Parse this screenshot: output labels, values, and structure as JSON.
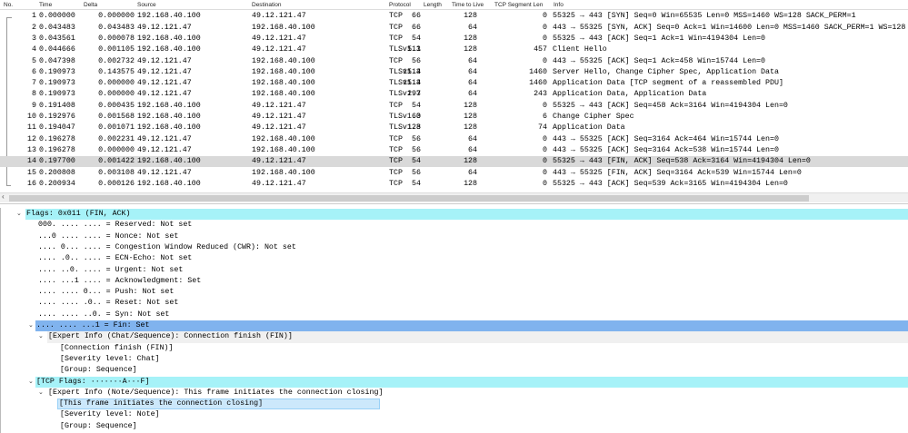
{
  "columns": [
    "No.",
    "Time",
    "Delta",
    "Source",
    "Destination",
    "Protocol",
    "Length",
    "Time to Live",
    "TCP Segment Len",
    "Info"
  ],
  "packets": [
    [
      "1",
      "0.000000",
      "0.000000",
      "192.168.40.100",
      "49.12.121.47",
      "TCP",
      "66",
      "128",
      "0",
      "55325 → 443 [SYN] Seq=0 Win=65535 Len=0 MSS=1460 WS=128 SACK_PERM=1"
    ],
    [
      "2",
      "0.043483",
      "0.043483",
      "49.12.121.47",
      "192.168.40.100",
      "TCP",
      "66",
      "64",
      "0",
      "443 → 55325 [SYN, ACK] Seq=0 Ack=1 Win=14600 Len=0 MSS=1460 SACK_PERM=1 WS=128"
    ],
    [
      "3",
      "0.043561",
      "0.000078",
      "192.168.40.100",
      "49.12.121.47",
      "TCP",
      "54",
      "128",
      "0",
      "55325 → 443 [ACK] Seq=1 Ack=1 Win=4194304 Len=0"
    ],
    [
      "4",
      "0.044666",
      "0.001105",
      "192.168.40.100",
      "49.12.121.47",
      "TLSv1.3",
      "511",
      "128",
      "457",
      "Client Hello"
    ],
    [
      "5",
      "0.047398",
      "0.002732",
      "49.12.121.47",
      "192.168.40.100",
      "TCP",
      "56",
      "64",
      "0",
      "443 → 55325 [ACK] Seq=1 Ack=458 Win=15744 Len=0"
    ],
    [
      "6",
      "0.190973",
      "0.143575",
      "49.12.121.47",
      "192.168.40.100",
      "TLSv1.3",
      "1514",
      "64",
      "1460",
      "Server Hello, Change Cipher Spec, Application Data"
    ],
    [
      "7",
      "0.190973",
      "0.000000",
      "49.12.121.47",
      "192.168.40.100",
      "TLSv1.3",
      "1514",
      "64",
      "1460",
      "Application Data [TCP segment of a reassembled PDU]"
    ],
    [
      "8",
      "0.190973",
      "0.000000",
      "49.12.121.47",
      "192.168.40.100",
      "TLSv1.3",
      "297",
      "64",
      "243",
      "Application Data, Application Data"
    ],
    [
      "9",
      "0.191408",
      "0.000435",
      "192.168.40.100",
      "49.12.121.47",
      "TCP",
      "54",
      "128",
      "0",
      "55325 → 443 [ACK] Seq=458 Ack=3164 Win=4194304 Len=0"
    ],
    [
      "10",
      "0.192976",
      "0.001568",
      "192.168.40.100",
      "49.12.121.47",
      "TLSv1.3",
      "60",
      "128",
      "6",
      "Change Cipher Spec"
    ],
    [
      "11",
      "0.194047",
      "0.001071",
      "192.168.40.100",
      "49.12.121.47",
      "TLSv1.3",
      "128",
      "128",
      "74",
      "Application Data"
    ],
    [
      "12",
      "0.196278",
      "0.002231",
      "49.12.121.47",
      "192.168.40.100",
      "TCP",
      "56",
      "64",
      "0",
      "443 → 55325 [ACK] Seq=3164 Ack=464 Win=15744 Len=0"
    ],
    [
      "13",
      "0.196278",
      "0.000000",
      "49.12.121.47",
      "192.168.40.100",
      "TCP",
      "56",
      "64",
      "0",
      "443 → 55325 [ACK] Seq=3164 Ack=538 Win=15744 Len=0"
    ],
    [
      "14",
      "0.197700",
      "0.001422",
      "192.168.40.100",
      "49.12.121.47",
      "TCP",
      "54",
      "128",
      "0",
      "55325 → 443 [FIN, ACK] Seq=538 Ack=3164 Win=4194304 Len=0"
    ],
    [
      "15",
      "0.200808",
      "0.003108",
      "49.12.121.47",
      "192.168.40.100",
      "TCP",
      "56",
      "64",
      "0",
      "443 → 55325 [FIN, ACK] Seq=3164 Ack=539 Win=15744 Len=0"
    ],
    [
      "16",
      "0.200934",
      "0.000126",
      "192.168.40.100",
      "49.12.121.47",
      "TCP",
      "54",
      "128",
      "0",
      "55325 → 443 [ACK] Seq=539 Ack=3165 Win=4194304 Len=0"
    ]
  ],
  "selected_packet": "14",
  "details": [
    {
      "text": "Flags: 0x011 (FIN, ACK)",
      "level": 0,
      "toggle": "expanded",
      "style": "cyan"
    },
    {
      "text": "000. .... .... = Reserved: Not set",
      "level": 1
    },
    {
      "text": "...0 .... .... = Nonce: Not set",
      "level": 1
    },
    {
      "text": ".... 0... .... = Congestion Window Reduced (CWR): Not set",
      "level": 1
    },
    {
      "text": ".... .0.. .... = ECN-Echo: Not set",
      "level": 1
    },
    {
      "text": ".... ..0. .... = Urgent: Not set",
      "level": 1
    },
    {
      "text": ".... ...1 .... = Acknowledgment: Set",
      "level": 1
    },
    {
      "text": ".... .... 0... = Push: Not set",
      "level": 1
    },
    {
      "text": ".... .... .0.. = Reset: Not set",
      "level": 1
    },
    {
      "text": ".... .... ..0. = Syn: Not set",
      "level": 1
    },
    {
      "text": ".... .... ...1 = Fin: Set",
      "level": 1,
      "toggle": "expanded",
      "style": "blue"
    },
    {
      "text": "[Expert Info (Chat/Sequence): Connection finish (FIN)]",
      "level": 2,
      "toggle": "expanded",
      "style": "gray"
    },
    {
      "text": "[Connection finish (FIN)]",
      "level": 3
    },
    {
      "text": "[Severity level: Chat]",
      "level": 3
    },
    {
      "text": "[Group: Sequence]",
      "level": 3
    },
    {
      "text": "[TCP Flags: ·······A···F]",
      "level": 1,
      "toggle": "expanded",
      "style": "cyan"
    },
    {
      "text": "[Expert Info (Note/Sequence): This frame initiates the connection closing]",
      "level": 2,
      "toggle": "expanded"
    },
    {
      "text": "[This frame initiates the connection closing]",
      "level": 3,
      "style": "lsel"
    },
    {
      "text": "[Severity level: Note]",
      "level": 3
    },
    {
      "text": "[Group: Sequence]",
      "level": 3
    }
  ]
}
